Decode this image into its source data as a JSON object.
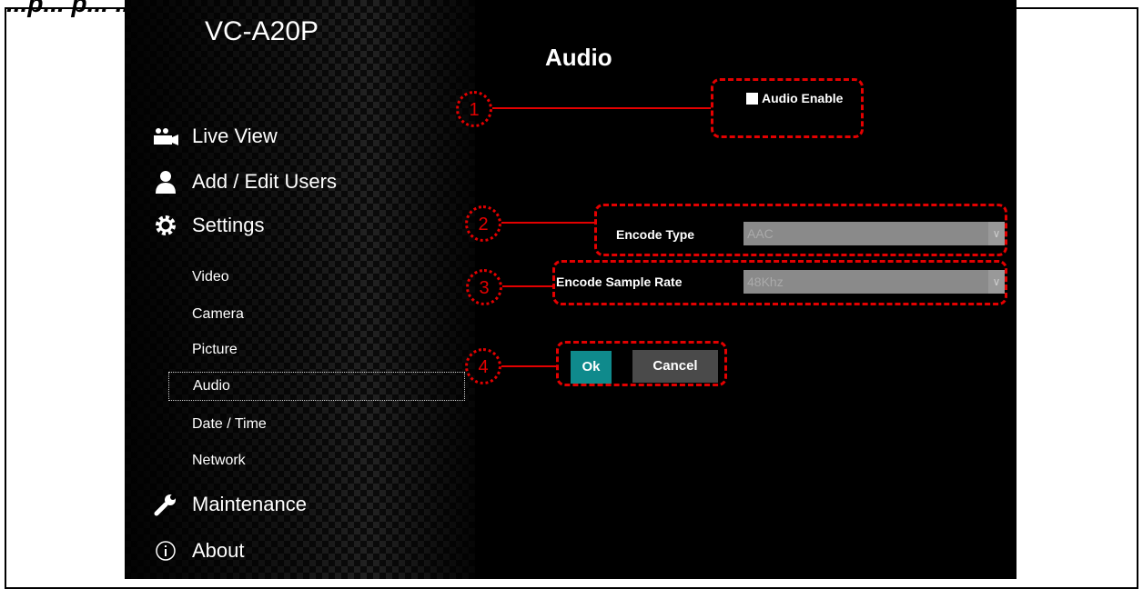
{
  "caption": "...p... p... ...y",
  "device_name": "VC-A20P",
  "page_title": "Audio",
  "nav": {
    "live_view": "Live View",
    "add_edit_users": "Add / Edit Users",
    "settings": "Settings",
    "video": "Video",
    "camera": "Camera",
    "picture": "Picture",
    "audio": "Audio",
    "date_time": "Date / Time",
    "network": "Network",
    "maintenance": "Maintenance",
    "about": "About"
  },
  "audio_enable_label": "Audio Enable",
  "audio_enable_checked": false,
  "encode_type": {
    "label": "Encode Type",
    "value": "AAC"
  },
  "sample_rate": {
    "label": "Encode Sample Rate",
    "value": "48Khz"
  },
  "buttons": {
    "ok": "Ok",
    "cancel": "Cancel"
  },
  "callouts": [
    "1",
    "2",
    "3",
    "4"
  ],
  "colors": {
    "accent": "#0f8a8c",
    "callout": "#e30000",
    "screen_bg": "#000000"
  }
}
